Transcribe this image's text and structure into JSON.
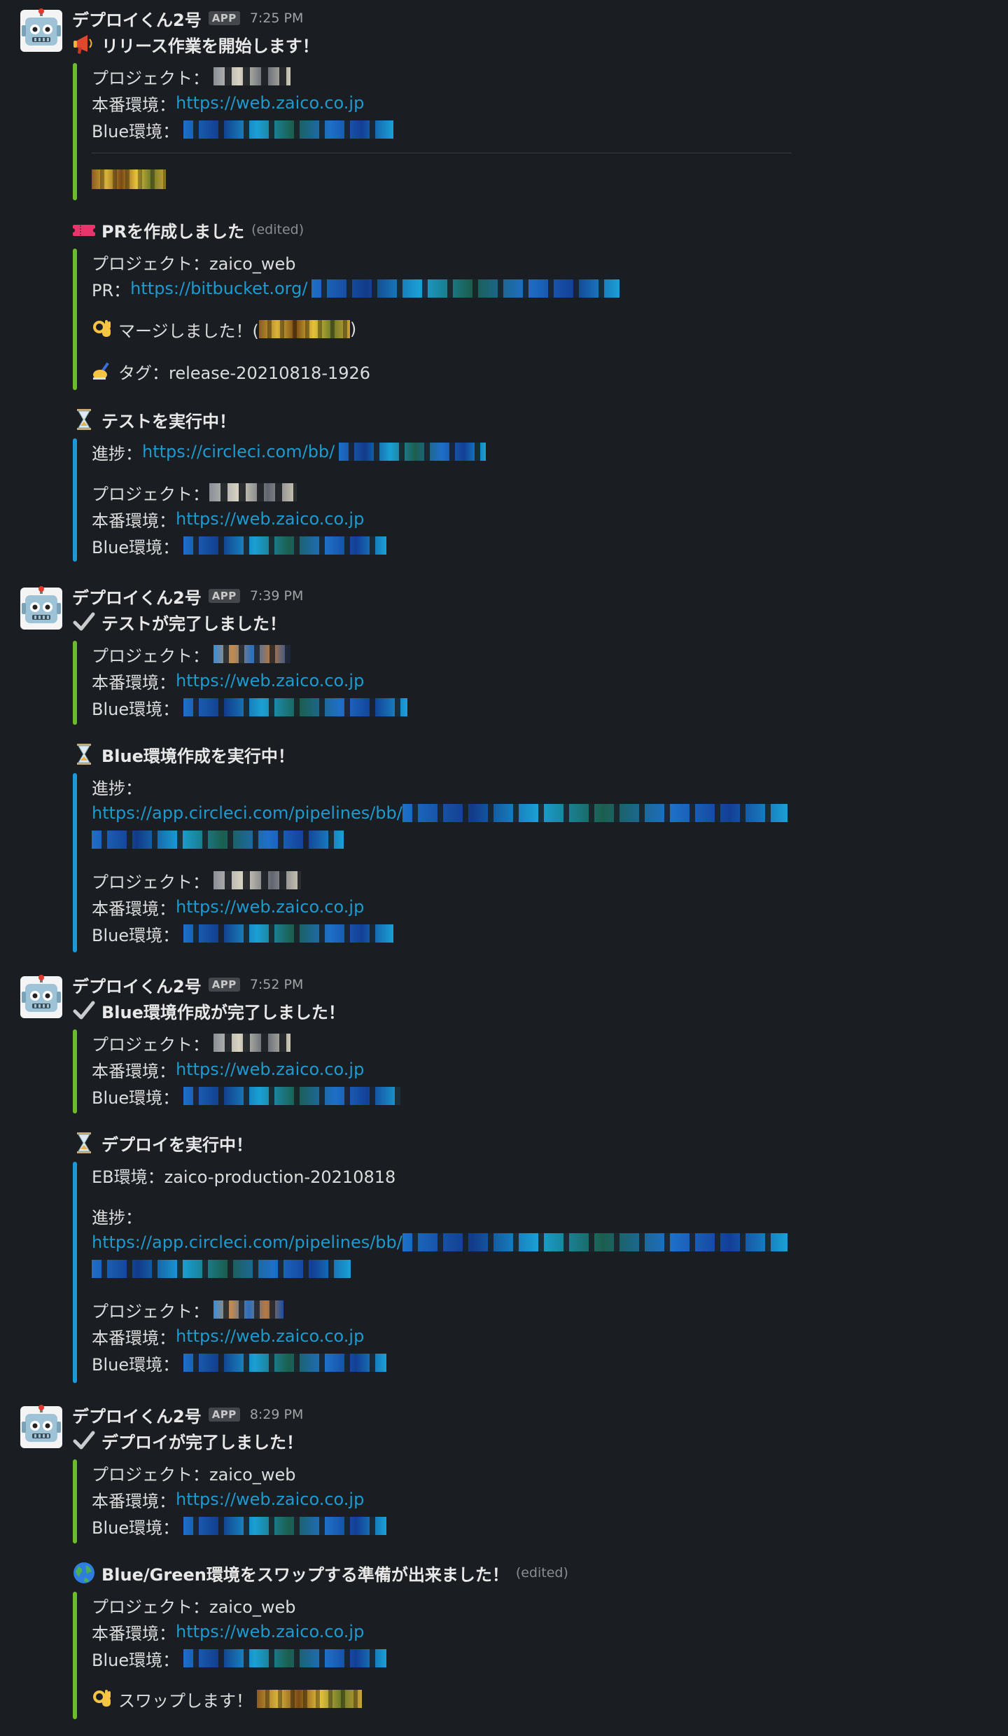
{
  "sender": {
    "name": "デプロイくん2号",
    "badge": "APP"
  },
  "messages": [
    {
      "time": "7:25 PM",
      "blocks": [
        {
          "icon": "megaphone-icon",
          "title": "リリース作業を開始します！",
          "bar": "green",
          "lines": [
            {
              "label": "プロジェクト：",
              "link": ""
            },
            {
              "label": "本番環境：",
              "link": "https://web.zaico.co.jp"
            },
            {
              "label": "Blue環境：",
              "link": ""
            }
          ]
        },
        {
          "icon": "ticket-icon",
          "title": "PRを作成しました",
          "edited": "(edited)",
          "bar": "green",
          "lines": [
            {
              "label": "プロジェクト：zaico_web",
              "link": ""
            },
            {
              "label": "PR：",
              "link": "https://bitbucket.org/"
            },
            {
              "label": "マージしました！(",
              "suffix": ")",
              "icon": "ok-hand-icon"
            },
            {
              "label": "タグ：release-20210818-1926",
              "icon": "writing-hand-icon"
            }
          ]
        },
        {
          "icon": "hourglass-icon",
          "title": "テストを実行中！",
          "bar": "blue",
          "lines": [
            {
              "label": "進捗：",
              "link": "https://circleci.com/bb/"
            },
            {
              "label": "プロジェクト：",
              "link": ""
            },
            {
              "label": "本番環境：",
              "link": "https://web.zaico.co.jp"
            },
            {
              "label": "Blue環境：",
              "link": ""
            }
          ]
        }
      ]
    },
    {
      "time": "7:39 PM",
      "blocks": [
        {
          "icon": "check-icon",
          "title": "テストが完了しました！",
          "bar": "green",
          "lines": [
            {
              "label": "プロジェクト：",
              "link": ""
            },
            {
              "label": "本番環境：",
              "link": "https://web.zaico.co.jp"
            },
            {
              "label": "Blue環境：",
              "link": ""
            }
          ]
        },
        {
          "icon": "hourglass-icon",
          "title": "Blue環境作成を実行中！",
          "bar": "blue",
          "lines": [
            {
              "label": "進捗：",
              "link": ""
            },
            {
              "label": "",
              "link": "https://app.circleci.com/pipelines/bb/"
            },
            {
              "label": "プロジェクト：",
              "link": ""
            },
            {
              "label": "本番環境：",
              "link": "https://web.zaico.co.jp"
            },
            {
              "label": "Blue環境：",
              "link": ""
            }
          ]
        }
      ]
    },
    {
      "time": "7:52 PM",
      "blocks": [
        {
          "icon": "check-icon",
          "title": "Blue環境作成が完了しました！",
          "bar": "green",
          "lines": [
            {
              "label": "プロジェクト：",
              "link": ""
            },
            {
              "label": "本番環境：",
              "link": "https://web.zaico.co.jp"
            },
            {
              "label": "Blue環境：",
              "link": ""
            }
          ]
        },
        {
          "icon": "hourglass-icon",
          "title": "デプロイを実行中！",
          "bar": "blue",
          "lines": [
            {
              "label": "EB環境：zaico-production-20210818",
              "link": ""
            },
            {
              "label": "進捗：",
              "link": ""
            },
            {
              "label": "",
              "link": "https://app.circleci.com/pipelines/bb/"
            },
            {
              "label": "プロジェクト：",
              "link": ""
            },
            {
              "label": "本番環境：",
              "link": "https://web.zaico.co.jp"
            },
            {
              "label": "Blue環境：",
              "link": ""
            }
          ]
        }
      ]
    },
    {
      "time": "8:29 PM",
      "blocks": [
        {
          "icon": "check-icon",
          "title": "デプロイが完了しました！",
          "bar": "green",
          "lines": [
            {
              "label": "プロジェクト：zaico_web",
              "link": ""
            },
            {
              "label": "本番環境：",
              "link": "https://web.zaico.co.jp"
            },
            {
              "label": "Blue環境：",
              "link": ""
            }
          ]
        },
        {
          "icon": "globe-icon",
          "title": "Blue/Green環境をスワップする準備が出来ました！",
          "edited": "(edited)",
          "bar": "green",
          "lines": [
            {
              "label": "プロジェクト：zaico_web",
              "link": ""
            },
            {
              "label": "本番環境：",
              "link": "https://web.zaico.co.jp"
            },
            {
              "label": "Blue環境：",
              "link": ""
            },
            {
              "label": "スワップします！",
              "icon": "ok-hand-icon"
            }
          ]
        }
      ]
    }
  ]
}
